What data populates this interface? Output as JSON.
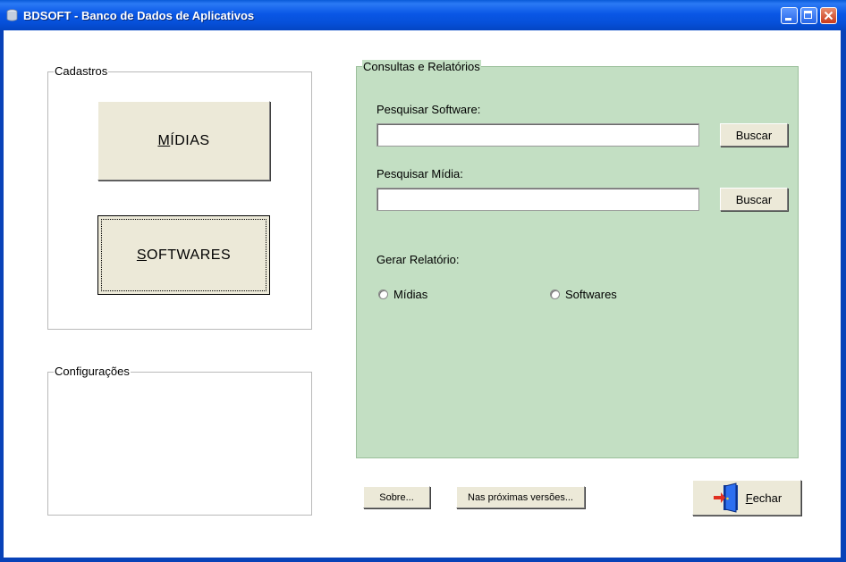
{
  "window": {
    "title": "BDSOFT - Banco de Dados de Aplicativos"
  },
  "cadastros": {
    "title": "Cadastros",
    "midias_button": {
      "accel": "M",
      "rest": "ÍDIAS"
    },
    "softwares_button": {
      "accel": "S",
      "rest": "OFTWARES"
    }
  },
  "configuracoes": {
    "title": "Configurações"
  },
  "consultas": {
    "title": "Consultas e Relatórios",
    "software_label": "Pesquisar Software:",
    "software_value": "",
    "midia_label": "Pesquisar Mídia:",
    "midia_value": "",
    "search_button_label": "Buscar",
    "report_label": "Gerar Relatório:",
    "report_options": [
      "Mídias",
      "Softwares"
    ]
  },
  "footer": {
    "sobre_label": "Sobre...",
    "proximas_label": "Nas próximas versões...",
    "fechar": {
      "accel": "F",
      "rest": "echar"
    }
  },
  "colors": {
    "titlebar": "#0a57e6",
    "panel_green": "#c3dfc3",
    "button_face": "#ece9d8"
  }
}
